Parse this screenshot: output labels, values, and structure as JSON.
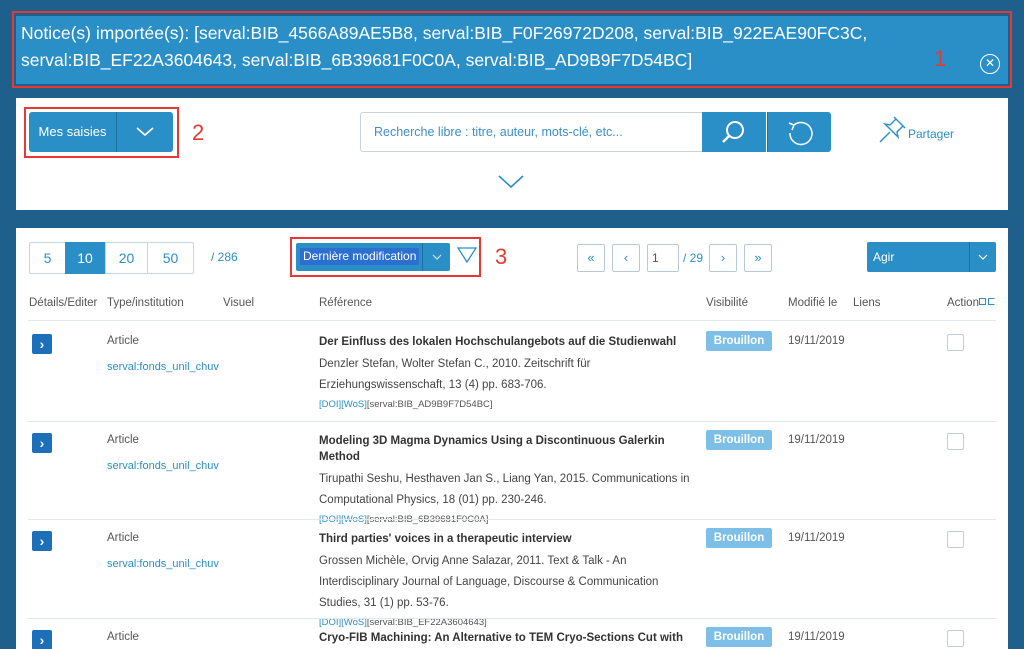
{
  "banner": {
    "text": "Notice(s) importée(s): [serval:BIB_4566A89AE5B8, serval:BIB_F0F26972D208, serval:BIB_922EAE90FC3C, serval:BIB_EF22A3604643, serval:BIB_6B39681F0C0A, serval:BIB_AD9B9F7D54BC]",
    "close_icon": "x"
  },
  "annotations": [
    "1",
    "2",
    "3"
  ],
  "toolbar": {
    "mes_saisies": "Mes saisies",
    "search_placeholder": "Recherche libre : titre, auteur, mots-clé, etc...",
    "share": "Partager"
  },
  "list": {
    "per_page_options": [
      "5",
      "10",
      "20",
      "50"
    ],
    "per_page_selected": "10",
    "total": "/ 286",
    "sort": "Dernière modification",
    "page_current": "1",
    "page_total": "/ 29",
    "first": "«",
    "prev": "‹",
    "next": "›",
    "last": "»",
    "agir": "Agir"
  },
  "columns": [
    "Détails/Editer",
    "Type/institution",
    "Visuel",
    "Référence",
    "Visibilité",
    "Modifié le",
    "Liens",
    "Action"
  ],
  "rows": [
    {
      "type": "Article",
      "institution": "serval:fonds_unil_chuv",
      "title": "Der Einfluss des lokalen Hochschulangebots auf die Studienwahl",
      "authors": "Denzler Stefan, Wolter Stefan C., 2010. Zeitschrift für Erziehungswissenschaft, 13 (4) pp. 683-706.",
      "links": [
        "[DOI]",
        "[WoS]",
        "[serval:BIB_AD9B9F7D54BC]"
      ],
      "visibility": "Brouillon",
      "modified": "19/11/2019"
    },
    {
      "type": "Article",
      "institution": "serval:fonds_unil_chuv",
      "title": "Modeling 3D Magma Dynamics Using a Discontinuous Galerkin Method",
      "authors": "Tirupathi Seshu, Hesthaven Jan S., Liang Yan, 2015. Communications in Computational Physics, 18 (01) pp. 230-246.",
      "links": [
        "[DOI]",
        "[WoS]",
        "[serval:BIB_6B39681F0C0A]"
      ],
      "visibility": "Brouillon",
      "modified": "19/11/2019"
    },
    {
      "type": "Article",
      "institution": "serval:fonds_unil_chuv",
      "title": "Third parties' voices in a therapeutic interview",
      "authors": "Grossen Michèle, Orvig Anne Salazar, 2011. Text & Talk - An Interdisciplinary Journal of Language, Discourse & Communication Studies, 31 (1) pp. 53-76.",
      "links": [
        "[DOI]",
        "[WoS]",
        "[serval:BIB_EF22A3604643]"
      ],
      "visibility": "Brouillon",
      "modified": "19/11/2019"
    },
    {
      "type": "Article",
      "institution": "",
      "title": "Cryo-FIB Machining: An Alternative to TEM Cryo-Sections Cut with",
      "authors": "",
      "links": [],
      "visibility": "Brouillon",
      "modified": "19/11/2019"
    }
  ]
}
